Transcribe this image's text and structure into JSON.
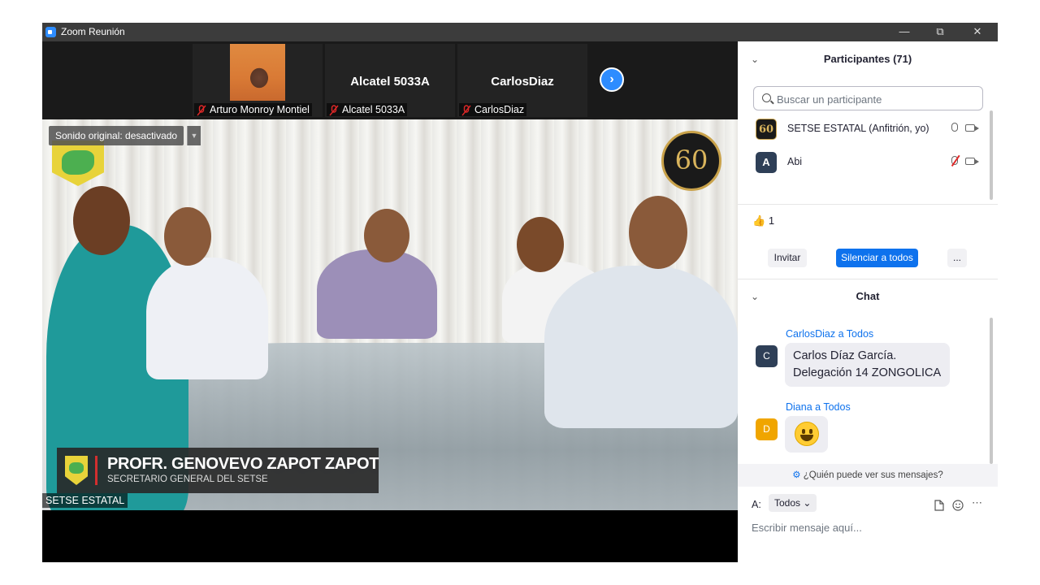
{
  "window": {
    "title": "Zoom Reunión",
    "controls": [
      "minimize",
      "restore",
      "close"
    ]
  },
  "gallery": {
    "tiles": [
      {
        "display_name": "",
        "label": "Arturo Monroy Montiel",
        "muted": true,
        "has_video": true
      },
      {
        "display_name": "Alcatel 5033A",
        "label": "Alcatel 5033A",
        "muted": true,
        "has_video": false
      },
      {
        "display_name": "CarlosDiaz",
        "label": "CarlosDiaz",
        "muted": true,
        "has_video": false
      }
    ],
    "next_icon": "chevron-right-icon"
  },
  "main_video": {
    "sound_status": "Sonido original: desactivado",
    "lower_third": {
      "name": "PROFR. GENOVEVO ZAPOT ZAPOT",
      "role": "SECRETARIO GENERAL DEL SETSE"
    },
    "logo_text": "60",
    "self_label": "SETSE ESTATAL"
  },
  "participants": {
    "header": "Participantes (71)",
    "search_placeholder": "Buscar un participante",
    "list": [
      {
        "name": "SETSE ESTATAL (Anfitrión, yo)",
        "avatar": "60",
        "avatar_color": "#1a1a1a",
        "mic": "on",
        "camera": "off"
      },
      {
        "name": "Abi",
        "avatar": "A",
        "avatar_color": "#2e3f57",
        "mic": "muted",
        "camera": "off"
      }
    ],
    "reaction": {
      "icon": "thumbs-up-icon",
      "emoji": "👍",
      "count": "1"
    },
    "buttons": {
      "invite": "Invitar",
      "mute_all": "Silenciar a todos",
      "more": "..."
    }
  },
  "chat": {
    "header": "Chat",
    "messages": [
      {
        "sender": "CarlosDiaz a Todos",
        "avatar": "C",
        "avatar_color": "#2e3f57",
        "lines": [
          "Carlos Díaz García.",
          "Delegación 14 ZONGOLICA"
        ]
      },
      {
        "sender": "Diana a Todos",
        "avatar": "D",
        "avatar_color": "#f0a500",
        "emoji": "grinning-face-icon"
      }
    ],
    "who_can_see": "¿Quién puede ver sus mensajes?",
    "to_label": "A:",
    "to_value": "Todos",
    "compose_placeholder": "Escribir mensaje aquí..."
  },
  "colors": {
    "accent": "#0e72ed",
    "zoom_blue": "#2d8cff",
    "muted_red": "#e02828"
  }
}
